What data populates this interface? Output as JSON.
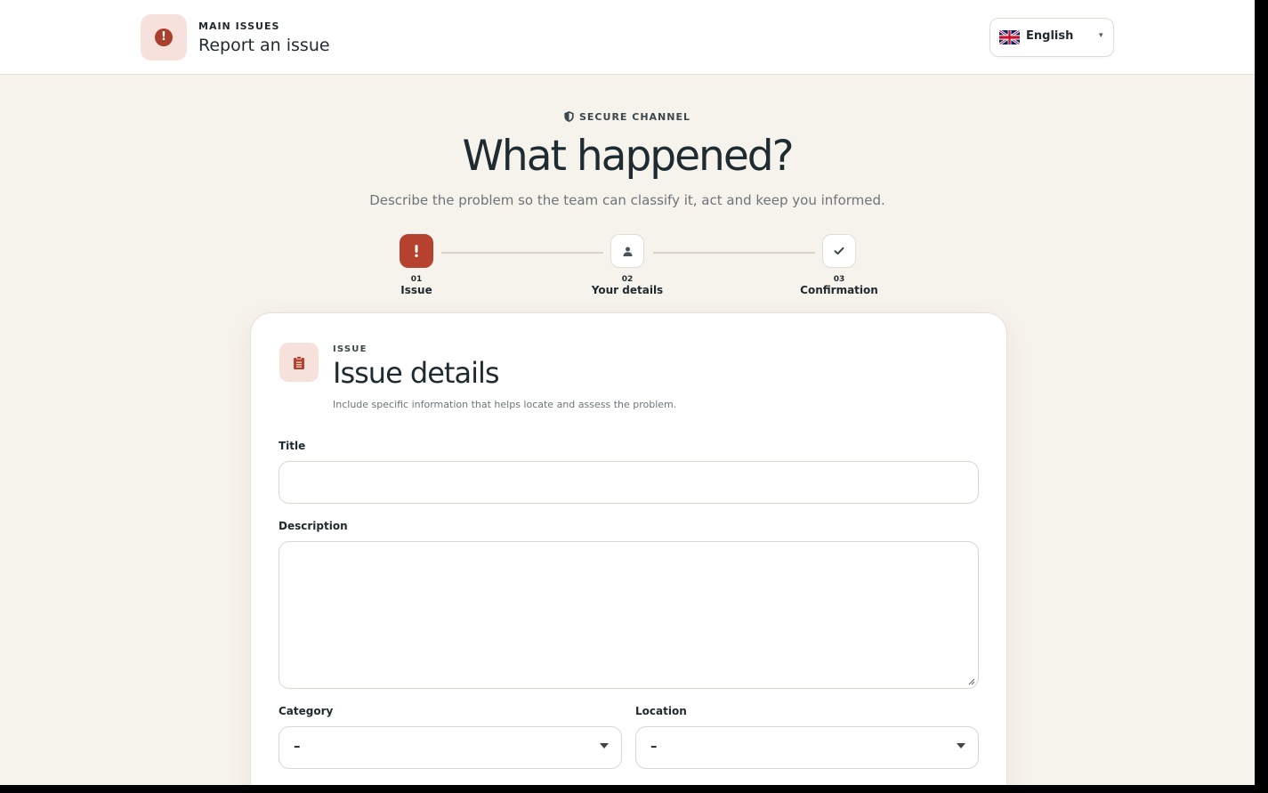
{
  "header": {
    "eyebrow": "MAIN ISSUES",
    "title": "Report an issue",
    "brand_icon": "alert-circle-icon",
    "language": {
      "selected": "English",
      "flag_icon": "uk-flag-icon"
    }
  },
  "hero": {
    "badge": "SECURE CHANNEL",
    "badge_icon": "shield-icon",
    "title": "What happened?",
    "subtitle": "Describe the problem so the team can classify it, act and keep you informed."
  },
  "stepper": {
    "steps": [
      {
        "number": "01",
        "label": "Issue",
        "icon": "exclamation-icon",
        "state": "active"
      },
      {
        "number": "02",
        "label": "Your details",
        "icon": "user-icon",
        "state": "upcoming"
      },
      {
        "number": "03",
        "label": "Confirmation",
        "icon": "check-icon",
        "state": "upcoming"
      }
    ]
  },
  "card": {
    "eyebrow": "ISSUE",
    "title": "Issue details",
    "subtitle": "Include specific information that helps locate and assess the problem.",
    "icon": "clipboard-icon",
    "fields": {
      "title_label": "Title",
      "title_value": "",
      "description_label": "Description",
      "description_value": "",
      "category_label": "Category",
      "category_value": "–",
      "location_label": "Location",
      "location_value": "–"
    }
  },
  "colors": {
    "accent": "#b6412f",
    "accent_soft": "#f6e1dc",
    "page_bg": "#f6f2ec",
    "text_dark": "#1e2b30",
    "text_muted": "#6d7579"
  }
}
